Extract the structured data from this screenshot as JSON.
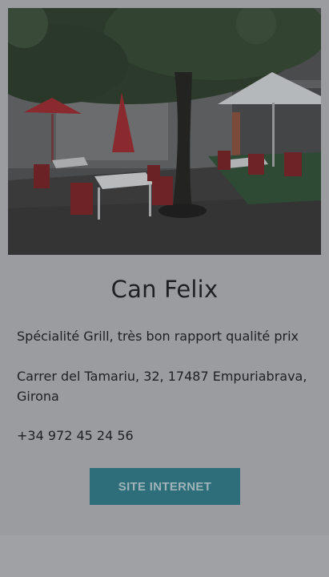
{
  "restaurant": {
    "name": "Can Felix",
    "description": "Spécialité Grill, très bon rapport qualité prix",
    "address": "Carrer del Tamariu, 32, 17487 Empuriabrava, Girona",
    "phone": "+34 972 45 24 56",
    "website_button": "SITE INTERNET"
  },
  "colors": {
    "overlay": "#9a9c9f",
    "button": "#2d6e7a",
    "text": "#1f2023"
  }
}
